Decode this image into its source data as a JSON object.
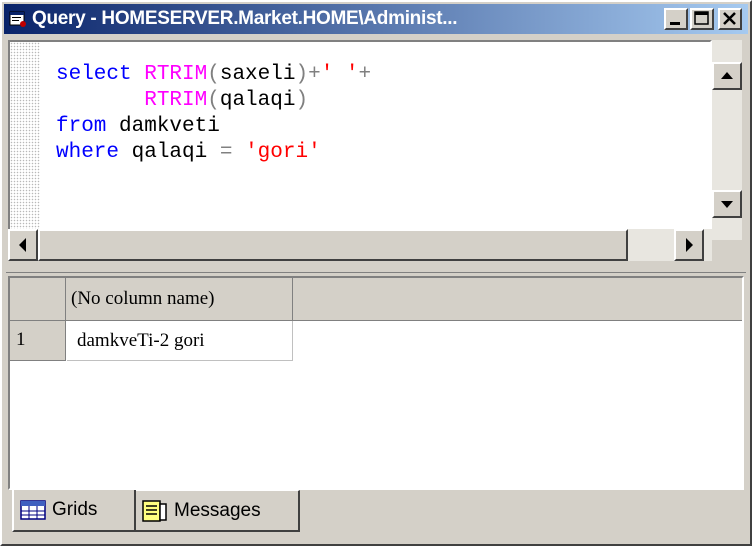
{
  "window": {
    "title": "Query - HOMESERVER.Market.HOME\\Administ..."
  },
  "editor": {
    "lines": [
      [
        {
          "t": "select ",
          "c": "kw"
        },
        {
          "t": "RTRIM",
          "c": "fn"
        },
        {
          "t": "(",
          "c": "op"
        },
        {
          "t": "saxeli",
          "c": "tx"
        },
        {
          "t": ")+",
          "c": "op"
        },
        {
          "t": "' '",
          "c": "str"
        },
        {
          "t": "+",
          "c": "op"
        }
      ],
      [
        {
          "t": "       ",
          "c": "tx"
        },
        {
          "t": "RTRIM",
          "c": "fn"
        },
        {
          "t": "(",
          "c": "op"
        },
        {
          "t": "qalaqi",
          "c": "tx"
        },
        {
          "t": ")",
          "c": "op"
        }
      ],
      [
        {
          "t": "from ",
          "c": "kw"
        },
        {
          "t": "damkveti",
          "c": "tx"
        }
      ],
      [
        {
          "t": "where ",
          "c": "kw"
        },
        {
          "t": "qalaqi ",
          "c": "tx"
        },
        {
          "t": "= ",
          "c": "op"
        },
        {
          "t": "'gori'",
          "c": "str"
        }
      ]
    ]
  },
  "results": {
    "columns": [
      "(No column name)"
    ],
    "rows": [
      {
        "num": "1",
        "cells": [
          "damkveTi-2 gori"
        ]
      }
    ]
  },
  "tabs": [
    {
      "label": "Grids",
      "icon": "grid-icon",
      "active": true
    },
    {
      "label": "Messages",
      "icon": "messages-icon",
      "active": false
    }
  ],
  "colors": {
    "keyword": "#0000ff",
    "function": "#ff00ff",
    "string": "#ff0000",
    "operator": "#808080",
    "title_start": "#0a246a",
    "title_end": "#a6caf0",
    "chrome": "#d4d0c8"
  }
}
